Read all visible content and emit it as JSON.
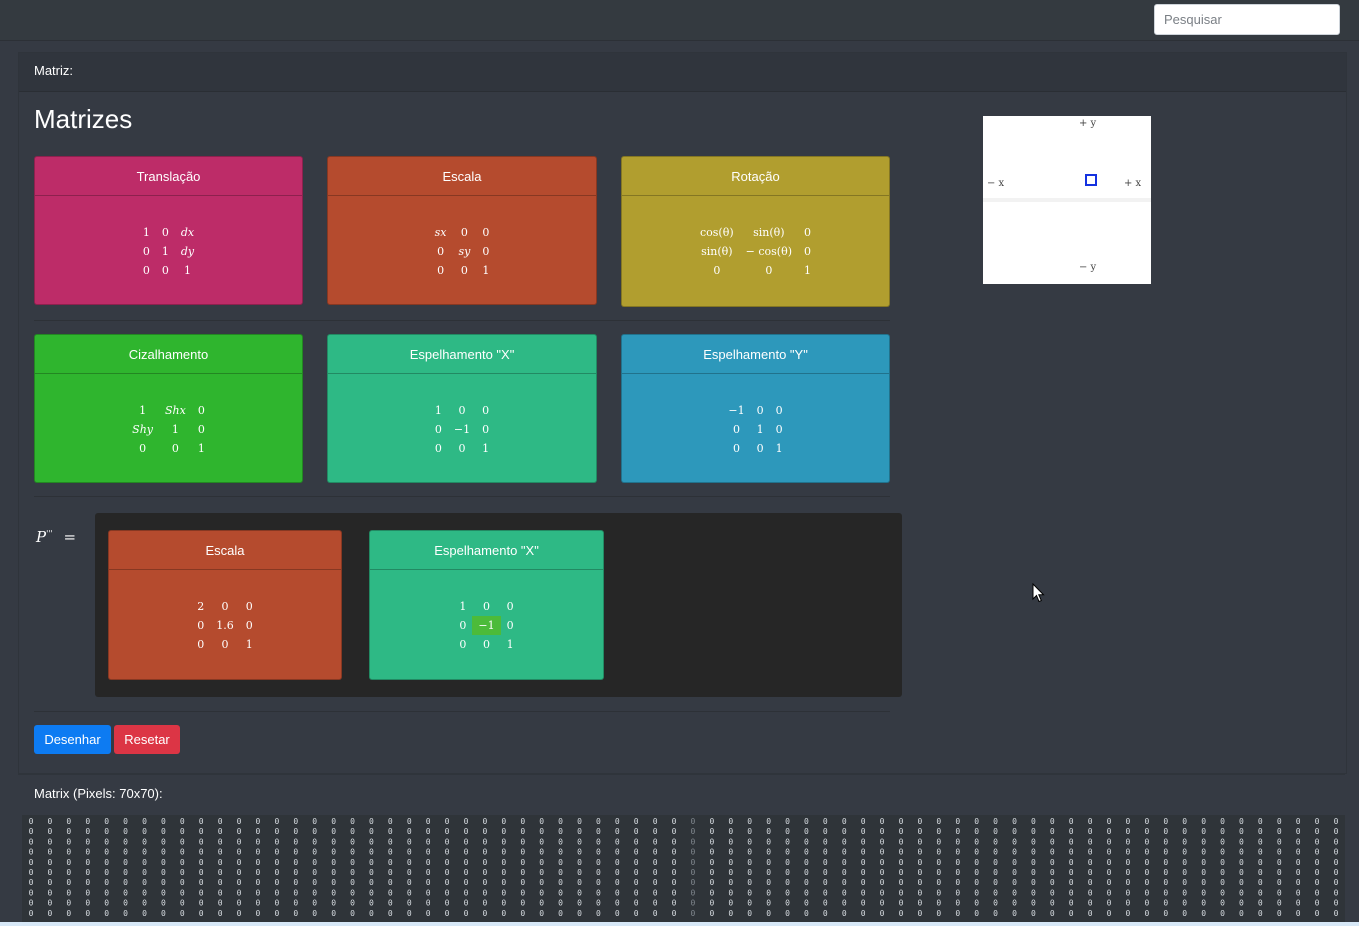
{
  "search": {
    "placeholder": "Pesquisar"
  },
  "card": {
    "header": "Matriz:",
    "title": "Matrizes"
  },
  "panels": [
    {
      "title": "Translação",
      "color": "#bd2c68",
      "rows": [
        [
          "1",
          "0",
          "dx"
        ],
        [
          "0",
          "1",
          "dy"
        ],
        [
          "0",
          "0",
          "1"
        ]
      ]
    },
    {
      "title": "Escala",
      "color": "#b54b2e",
      "rows": [
        [
          "sx",
          "0",
          "0"
        ],
        [
          "0",
          "sy",
          "0"
        ],
        [
          "0",
          "0",
          "1"
        ]
      ]
    },
    {
      "title": "Rotação",
      "color": "#b19e2f",
      "rows": [
        [
          "cos(θ)",
          "sin(θ)",
          "0"
        ],
        [
          "sin(θ)",
          "− cos(θ)",
          "0"
        ],
        [
          "0",
          "0",
          "1"
        ]
      ]
    },
    {
      "title": "Cizalhamento",
      "color": "#2fb52e",
      "rows": [
        [
          "1",
          "Shx",
          "0"
        ],
        [
          "Shy",
          "1",
          "0"
        ],
        [
          "0",
          "0",
          "1"
        ]
      ]
    },
    {
      "title": "Espelhamento \"X\"",
      "color": "#2eb985",
      "rows": [
        [
          "1",
          "0",
          "0"
        ],
        [
          "0",
          "−1",
          "0"
        ],
        [
          "0",
          "0",
          "1"
        ]
      ]
    },
    {
      "title": "Espelhamento \"Y\"",
      "color": "#2d98bb",
      "rows": [
        [
          "−1",
          "0",
          "0"
        ],
        [
          "0",
          "1",
          "0"
        ],
        [
          "0",
          "0",
          "1"
        ]
      ]
    }
  ],
  "result": {
    "label": "P",
    "label_sup": "'''",
    "equals": "=",
    "panels": [
      {
        "title": "Escala",
        "color": "#b54b2e",
        "rows": [
          [
            "2",
            "0",
            "0"
          ],
          [
            "0",
            "1.6",
            "0"
          ],
          [
            "0",
            "0",
            "1"
          ]
        ]
      },
      {
        "title": "Espelhamento \"X\"",
        "color": "#2eb985",
        "rows": [
          [
            "1",
            "0",
            "0"
          ],
          [
            "0",
            "−1",
            "0"
          ],
          [
            "0",
            "0",
            "1"
          ]
        ]
      }
    ]
  },
  "buttons": {
    "draw": "Desenhar",
    "reset": "Resetar"
  },
  "preview": {
    "plus_y": "+ y",
    "minus_y": "− y",
    "plus_x": "+ x",
    "minus_x": "− x"
  },
  "matrix": {
    "label": "Matrix (Pixels: 70x70):",
    "cell_value": "0",
    "columns": 70,
    "visible_rows": 10
  }
}
